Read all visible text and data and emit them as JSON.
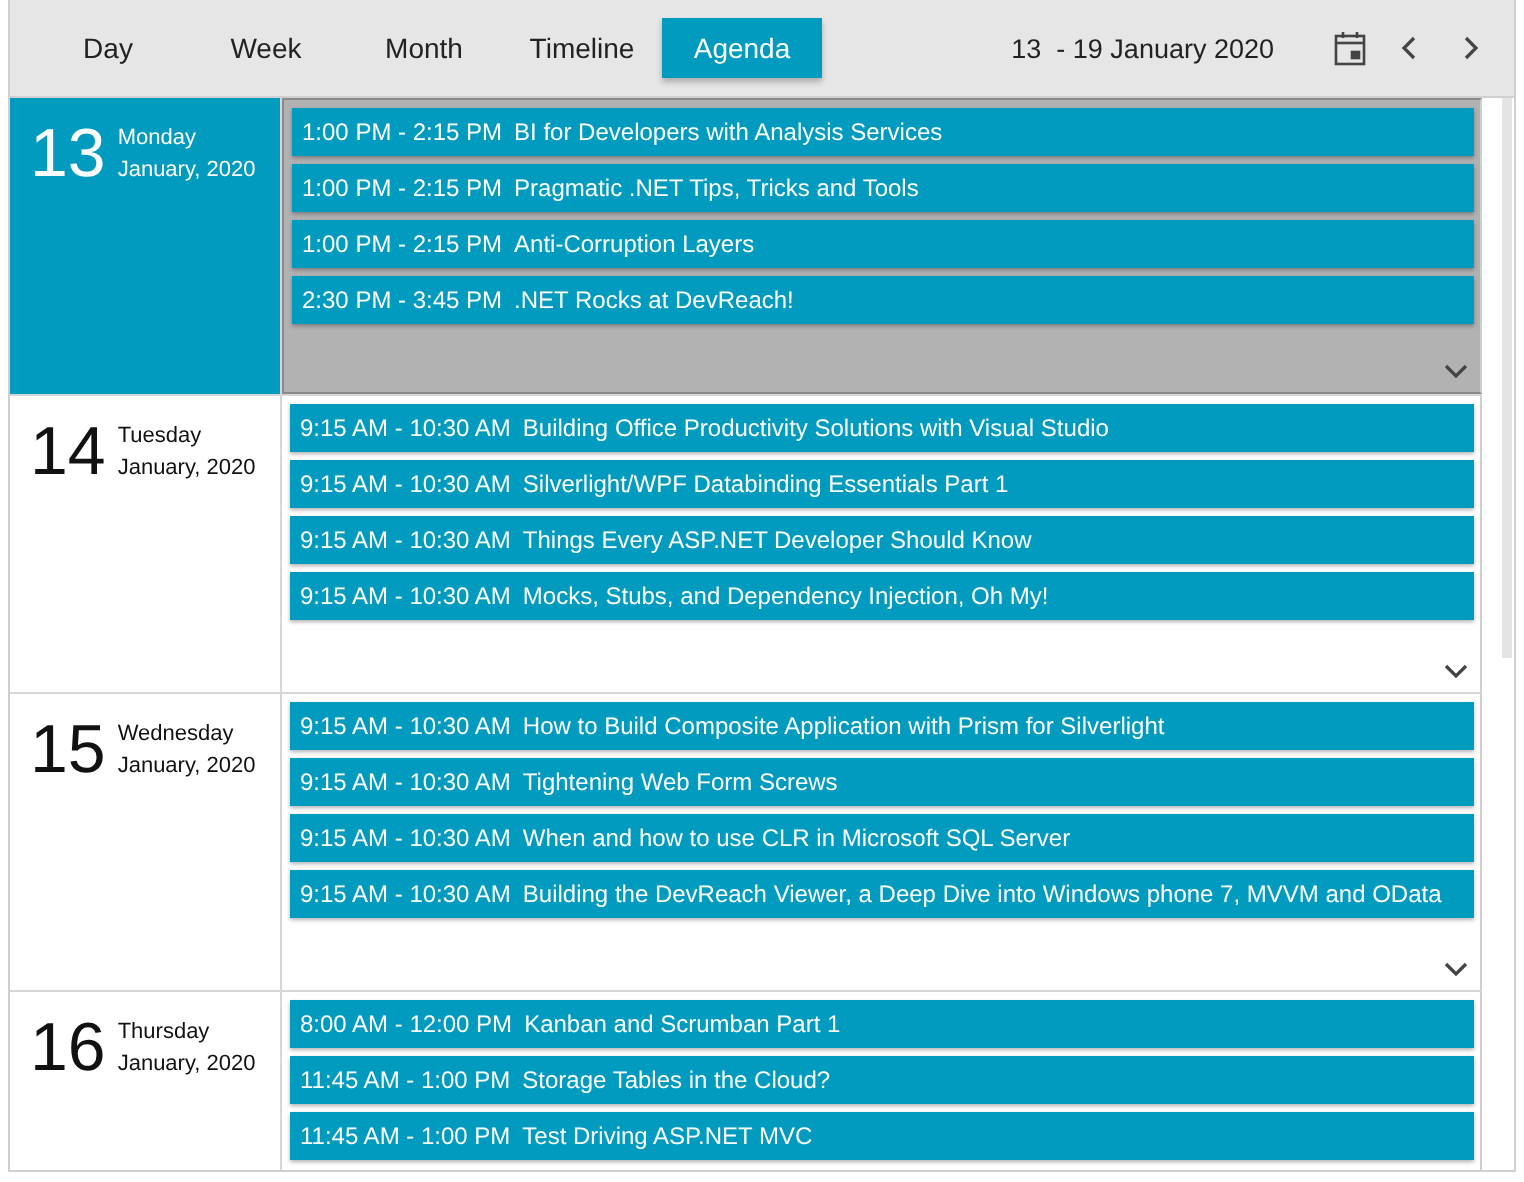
{
  "view_tabs": [
    {
      "label": "Day",
      "selected": false
    },
    {
      "label": "Week",
      "selected": false
    },
    {
      "label": "Month",
      "selected": false
    },
    {
      "label": "Timeline",
      "selected": false
    },
    {
      "label": "Agenda",
      "selected": true
    }
  ],
  "date_range": "13  - 19 January 2020",
  "days": [
    {
      "number": "13",
      "weekday": "Monday",
      "month_year": "January, 2020",
      "selected": true,
      "more": true,
      "appointments": [
        {
          "time": "1:00 PM - 2:15 PM",
          "title": "BI for Developers with Analysis Services"
        },
        {
          "time": "1:00 PM - 2:15 PM",
          "title": "Pragmatic .NET Tips, Tricks and Tools"
        },
        {
          "time": "1:00 PM - 2:15 PM",
          "title": "Anti-Corruption Layers"
        },
        {
          "time": "2:30 PM - 3:45 PM",
          "title": ".NET Rocks at DevReach!"
        }
      ]
    },
    {
      "number": "14",
      "weekday": "Tuesday",
      "month_year": "January, 2020",
      "selected": false,
      "more": true,
      "appointments": [
        {
          "time": "9:15 AM - 10:30 AM",
          "title": "Building Office Productivity Solutions with Visual Studio"
        },
        {
          "time": "9:15 AM - 10:30 AM",
          "title": "Silverlight/WPF Databinding Essentials Part 1"
        },
        {
          "time": "9:15 AM - 10:30 AM",
          "title": "Things Every ASP.NET Developer Should Know"
        },
        {
          "time": "9:15 AM - 10:30 AM",
          "title": "Mocks, Stubs, and Dependency Injection, Oh My!"
        }
      ]
    },
    {
      "number": "15",
      "weekday": "Wednesday",
      "month_year": "January, 2020",
      "selected": false,
      "more": true,
      "appointments": [
        {
          "time": "9:15 AM - 10:30 AM",
          "title": "How to Build Composite Application with Prism for Silverlight"
        },
        {
          "time": "9:15 AM - 10:30 AM",
          "title": "Tightening Web Form Screws"
        },
        {
          "time": "9:15 AM - 10:30 AM",
          "title": "When and how to use CLR in Microsoft SQL Server"
        },
        {
          "time": "9:15 AM - 10:30 AM",
          "title": "Building the DevReach Viewer, a Deep Dive into Windows phone 7, MVVM and OData"
        }
      ]
    },
    {
      "number": "16",
      "weekday": "Thursday",
      "month_year": "January, 2020",
      "selected": false,
      "more": false,
      "appointments": [
        {
          "time": "8:00 AM - 12:00 PM",
          "title": "Kanban and Scrumban Part 1"
        },
        {
          "time": "11:45 AM - 1:00 PM",
          "title": "Storage Tables in the Cloud?"
        },
        {
          "time": "11:45 AM - 1:00 PM",
          "title": "Test Driving ASP.NET MVC"
        }
      ]
    }
  ]
}
